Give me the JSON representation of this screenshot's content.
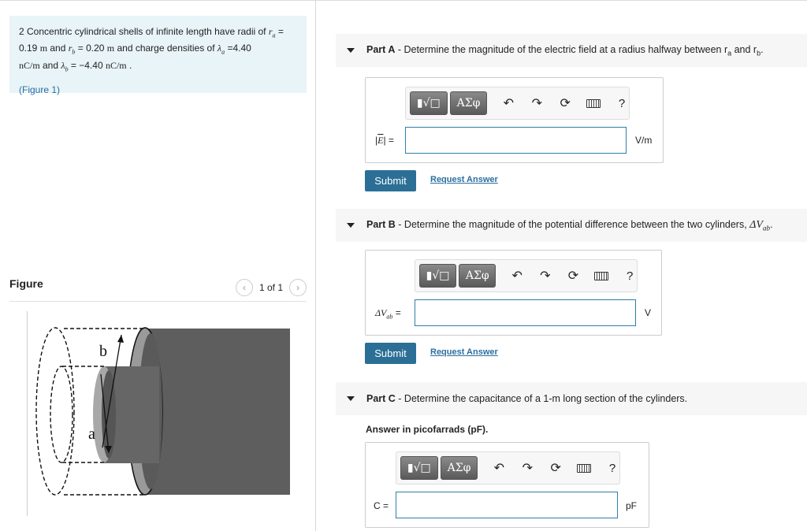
{
  "problem": {
    "text_line1_pre": "2 Concentric cylindrical shells of infinite length have radii of ",
    "ra_symbol": "r",
    "ra_sub": "a",
    "ra_eq": " = ",
    "text_line2_ra": "0.19 ",
    "unit_m1": "m",
    "and1": " and ",
    "rb_symbol": "r",
    "rb_sub": "b",
    "rb_value": " = 0.20 ",
    "unit_m2": "m",
    "and2": " and charge densities of ",
    "la_symbol": "λ",
    "la_sub": "a",
    "la_value": " =4.40",
    "unit_ncm1": "nC/m",
    "and3": " and ",
    "lb_symbol": "λ",
    "lb_sub": "b",
    "lb_value": " = −4.40 ",
    "unit_ncm2": "nC/m",
    "end": " .",
    "figure_link": "(Figure 1)"
  },
  "figure": {
    "title": "Figure",
    "pager_text": "1 of 1",
    "prev_icon": "chevron-left-icon",
    "next_icon": "chevron-right-icon",
    "label_b": "b",
    "label_a": "a"
  },
  "parts": {
    "a": {
      "label": "Part A",
      "text": " - Determine the magnitude of the electric field at a radius halfway between r",
      "sub1": "a",
      "mid": " and r",
      "sub2": "b",
      "end": ".",
      "input_label_symbol": "E",
      "input_label_suffix": " =",
      "unit": "V/m",
      "submit": "Submit",
      "request": "Request Answer"
    },
    "b": {
      "label": "Part B",
      "text": " - Determine the magnitude of the potential difference between the two cylinders, ",
      "math": "ΔV",
      "math_sub": "ab",
      "end": ".",
      "input_label": "ΔV",
      "input_label_sub": "ab",
      "input_label_suffix": " =",
      "unit": "V",
      "submit": "Submit",
      "request": "Request Answer"
    },
    "c": {
      "label": "Part C",
      "text": " - Determine the capacitance of a 1-m long section of the cylinders.",
      "instruction": "Answer in picofarrads (pF).",
      "input_label": "C =",
      "unit": "pF"
    }
  },
  "toolbar": {
    "template_label": "▮√□",
    "greek_label": "ΑΣφ",
    "undo_icon": "undo-icon",
    "redo_icon": "redo-icon",
    "reset_icon": "reset-icon",
    "keyboard_icon": "keyboard-icon",
    "help_label": "?"
  },
  "colors": {
    "problem_bg": "#e8f4f8",
    "accent": "#2b6f96",
    "link": "#2b6ea0"
  }
}
